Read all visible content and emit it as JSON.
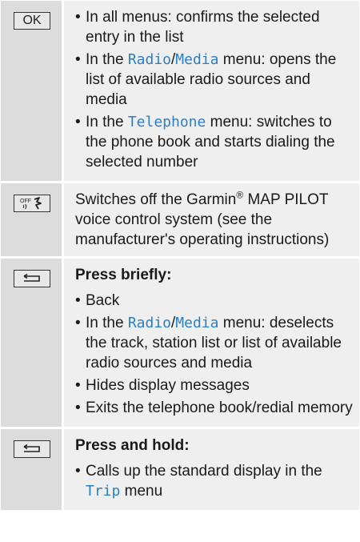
{
  "rows": [
    {
      "key": "OK",
      "bullets": [
        [
          "In all menus: confirms the selected entry in the list"
        ],
        [
          "In the ",
          {
            "hl": "Radio"
          },
          "/",
          {
            "hl": "Media"
          },
          " menu: opens the list of available radio sources and media"
        ],
        [
          "In the ",
          {
            "hl": "Telephone"
          },
          " menu: switches to the phone book and starts dialing the selected number"
        ]
      ]
    },
    {
      "key_icon": "voice-off-icon",
      "key_text": "OFF",
      "text_before": "Switches off the Garmin",
      "text_sup": "®",
      "text_after": " MAP PILOT voice control system (see the manufacturer's operating instructions)"
    },
    {
      "key_icon": "back-icon",
      "heading": "Press briefly:",
      "bullets": [
        [
          "Back"
        ],
        [
          "In the ",
          {
            "hl": "Radio"
          },
          "/",
          {
            "hl": "Media"
          },
          " menu: deselects the track, station list or list of available radio sources and media"
        ],
        [
          "Hides display messages"
        ],
        [
          "Exits the telephone book/redial memory"
        ]
      ]
    },
    {
      "key_icon": "back-icon",
      "heading": "Press and hold:",
      "bullets": [
        [
          "Calls up the standard display in the ",
          {
            "hl": "Trip"
          },
          " menu"
        ]
      ]
    }
  ],
  "colors": {
    "highlight": "#2a7fc8",
    "key_column": "#dcdcdc",
    "desc_column": "#efefef"
  }
}
